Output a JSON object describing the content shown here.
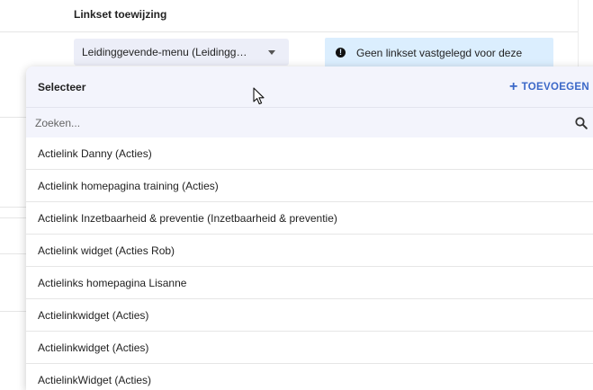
{
  "section": {
    "title": "Linkset toewijzing"
  },
  "select": {
    "value": "Leidinggevende-menu (Leidingg…"
  },
  "info": {
    "text": "Geen linkset vastgelegd voor deze"
  },
  "dropdown": {
    "title": "Selecteer",
    "add_label": "TOEVOEGEN",
    "search_placeholder": "Zoeken...",
    "items": [
      "Actielink Danny (Acties)",
      "Actielink homepagina training (Acties)",
      "Actielink Inzetbaarheid & preventie (Inzetbaarheid & preventie)",
      "Actielink widget (Acties Rob)",
      "Actielinks homepagina Lisanne",
      "Actielinkwidget (Acties)",
      "Actielinkwidget (Acties)",
      "ActielinkWidget (Acties)"
    ]
  },
  "colors": {
    "accent": "#3b68c8",
    "info_bg": "#dbeefe",
    "select_bg": "#eceef8"
  },
  "icons": [
    "chevron-down-icon",
    "info-icon",
    "plus-icon",
    "search-icon",
    "mouse-cursor-icon"
  ]
}
